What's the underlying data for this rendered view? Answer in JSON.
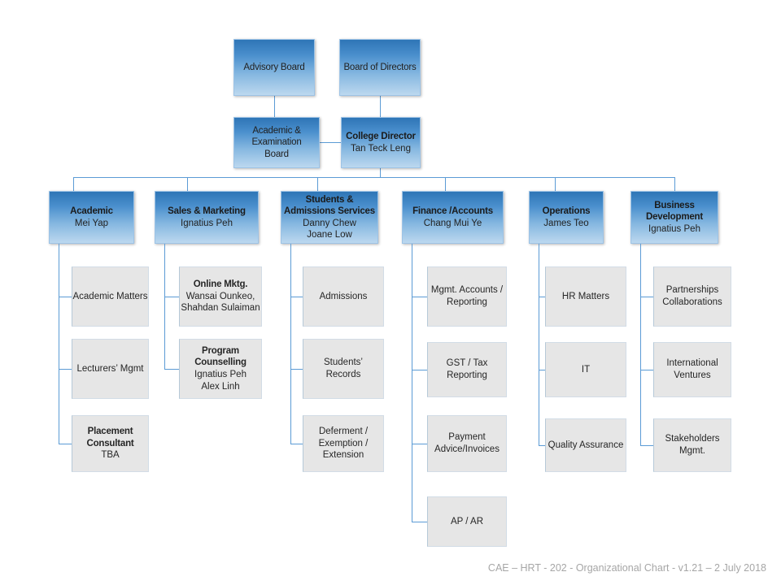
{
  "chart": {
    "title_footer": "CAE – HRT - 202 - Organizational Chart - v1.21 – 2 July 2018",
    "colors": {
      "node_top": "#2e75b6",
      "node_bottom": "#bcd8ef",
      "leaf_fill": "#e6e6e6",
      "connector": "#5b9bd5",
      "footer_text": "#a6a6a6"
    }
  },
  "top": {
    "advisory_board": {
      "title": "Advisory Board"
    },
    "board_of_directors": {
      "title": "Board of Directors"
    },
    "academic_exam_board": {
      "l1": "Academic &",
      "l2": "Examination",
      "l3": "Board"
    },
    "college_director": {
      "title": "College Director",
      "person": "Tan Teck Leng"
    }
  },
  "departments": [
    {
      "id": "academic",
      "title": "Academic",
      "person": "Mei Yap",
      "children": [
        {
          "title": "Academic Matters",
          "bold": false,
          "people": []
        },
        {
          "title": "Lecturers’  Mgmt",
          "bold": false,
          "people": []
        },
        {
          "title": "Placement  Consultant",
          "bold": true,
          "people": [
            "TBA"
          ]
        }
      ]
    },
    {
      "id": "sales-marketing",
      "title": "Sales & Marketing",
      "person": "Ignatius Peh",
      "children": [
        {
          "title": "Online Mktg.",
          "bold": true,
          "people": [
            "Wansai Ounkeo,",
            "Shahdan Sulaiman"
          ]
        },
        {
          "title": "Program\nCounselling",
          "bold": true,
          "people": [
            "Ignatius Peh",
            "Alex Linh"
          ]
        }
      ]
    },
    {
      "id": "students-admissions",
      "title": "Students &\nAdmissions Services",
      "person": "Danny Chew\nJoane Low",
      "children": [
        {
          "title": "Admissions",
          "bold": false,
          "people": []
        },
        {
          "title": "Students’\nRecords",
          "bold": false,
          "people": []
        },
        {
          "title": "Deferment  /\nExemption  /\nExtension",
          "bold": false,
          "people": []
        }
      ]
    },
    {
      "id": "finance-accounts",
      "title": "Finance /Accounts",
      "person": "Chang Mui Ye",
      "children": [
        {
          "title": "Mgmt.  Accounts /\nReporting",
          "bold": false,
          "people": []
        },
        {
          "title": "GST / Tax\nReporting",
          "bold": false,
          "people": []
        },
        {
          "title": "Payment\nAdvice/Invoices",
          "bold": false,
          "people": []
        },
        {
          "title": "AP / AR",
          "bold": false,
          "people": []
        }
      ]
    },
    {
      "id": "operations",
      "title": "Operations",
      "person": "James Teo",
      "children": [
        {
          "title": "HR Matters",
          "bold": false,
          "people": []
        },
        {
          "title": "IT",
          "bold": false,
          "people": []
        },
        {
          "title": "Quality Assurance",
          "bold": false,
          "people": []
        }
      ]
    },
    {
      "id": "business-development",
      "title": "Business\nDevelopment",
      "person": "Ignatius Peh",
      "children": [
        {
          "title": "Partnerships\nCollaborations",
          "bold": false,
          "people": []
        },
        {
          "title": "International\nVentures",
          "bold": false,
          "people": []
        },
        {
          "title": "Stakeholders\nMgmt.",
          "bold": false,
          "people": []
        }
      ]
    }
  ]
}
